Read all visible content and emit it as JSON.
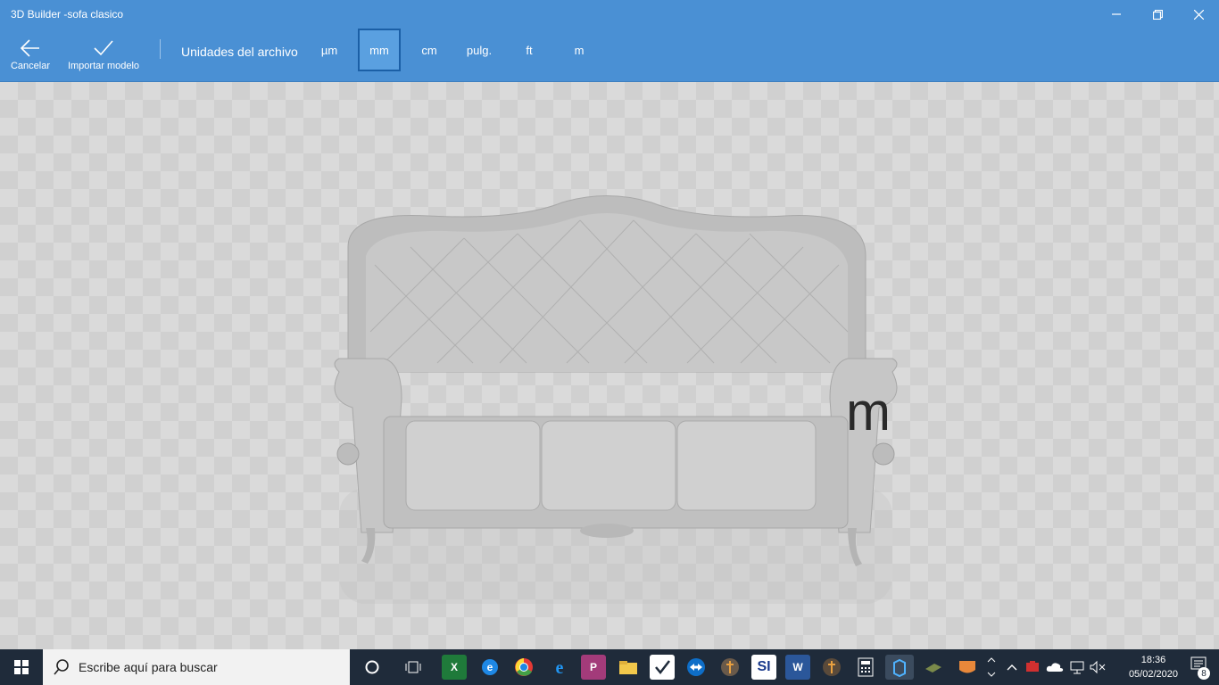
{
  "window": {
    "title": "3D Builder -sofa clasico"
  },
  "toolbar": {
    "cancel_label": "Cancelar",
    "import_label": "Importar modelo",
    "units_label": "Unidades del archivo",
    "units": [
      "µm",
      "mm",
      "cm",
      "pulg.",
      "ft",
      "m"
    ],
    "selected_unit": "mm"
  },
  "canvas": {
    "unit_indicator": "m"
  },
  "taskbar": {
    "search_placeholder": "Escribe aquí para buscar",
    "time": "18:36",
    "date": "05/02/2020",
    "notification_count": "8",
    "pinned_icons": [
      "task-view-icon",
      "excel-icon",
      "edge-icon",
      "chrome-icon",
      "ie-icon",
      "powerapp-icon",
      "file-explorer-icon",
      "checkbox-app-icon",
      "teamviewer-icon",
      "app-icon",
      "si-icon",
      "word-icon",
      "app2-icon",
      "calculator-icon",
      "3d-builder-icon",
      "game-icon",
      "shield-app-icon"
    ],
    "si_label": "SI"
  }
}
